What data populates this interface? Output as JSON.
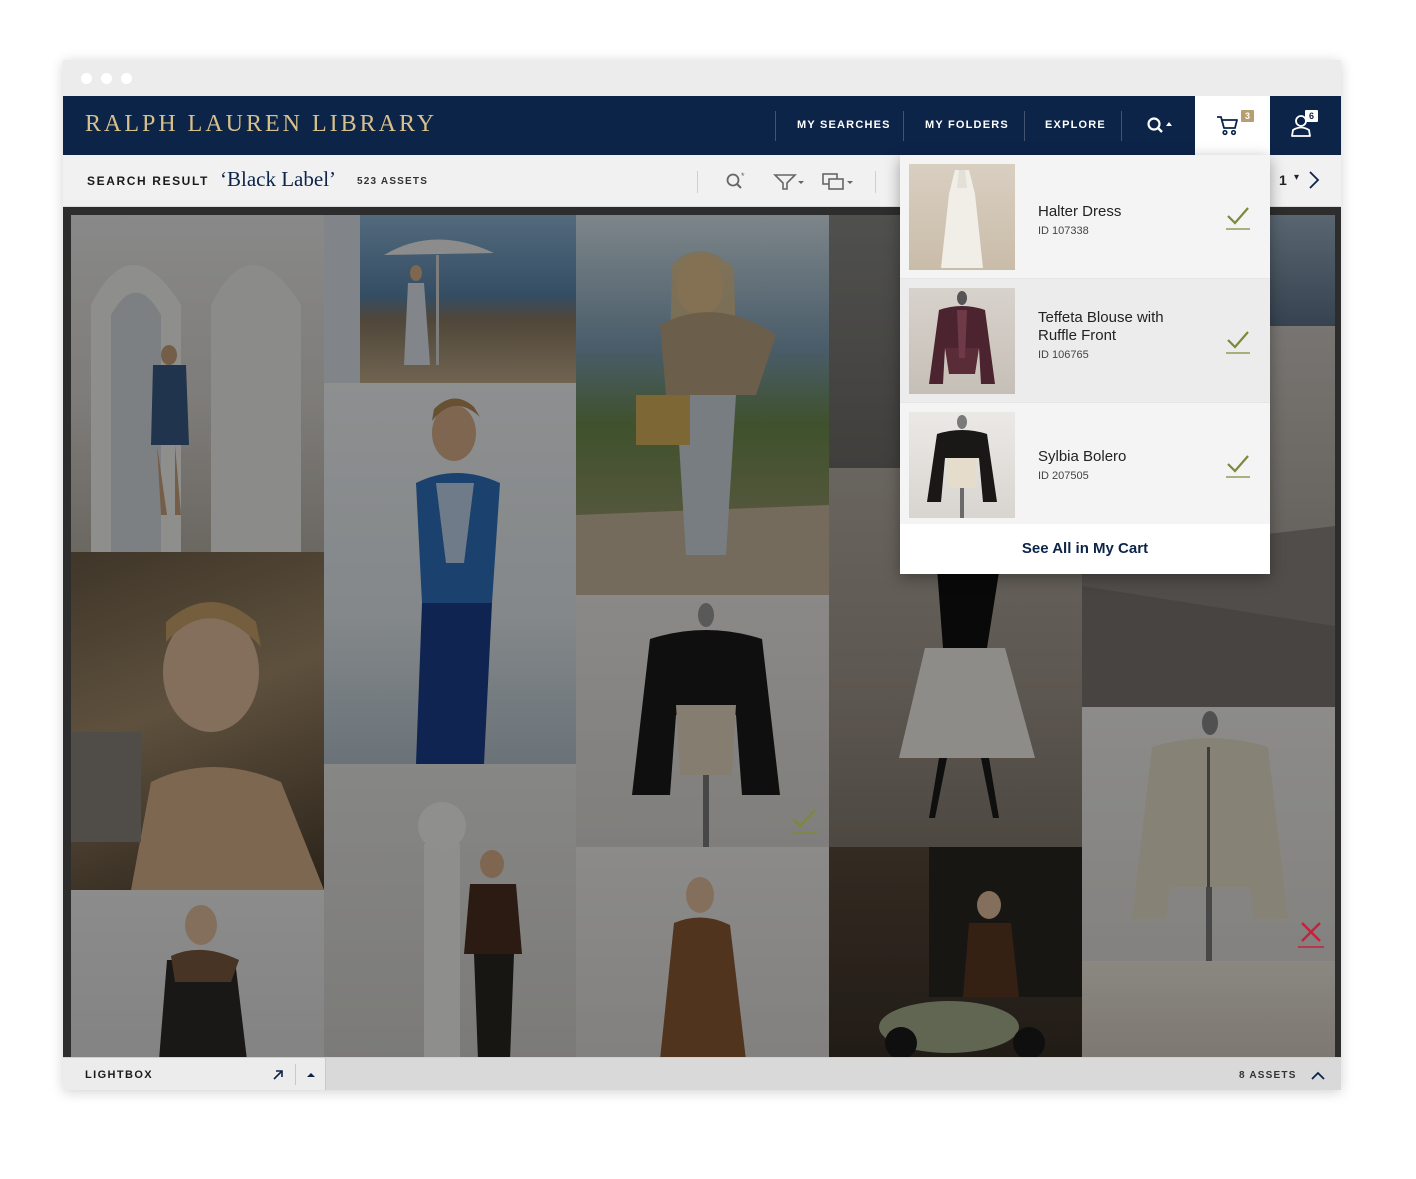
{
  "app": {
    "brand": "RALPH LAUREN LIBRARY"
  },
  "nav": {
    "my_searches": "MY SEARCHES",
    "my_folders": "MY FOLDERS",
    "explore": "EXPLORE",
    "search_icon": "search-icon",
    "cart_icon": "cart-icon",
    "cart_count": "3",
    "user_icon": "user-icon",
    "user_count": "6"
  },
  "search_bar": {
    "label": "SEARCH RESULT",
    "query": "‘Black Label’",
    "count": "523 ASSETS",
    "page": "1",
    "tools": [
      "zoom-search-icon",
      "filter-icon",
      "view-mode-icon"
    ]
  },
  "cart_dropdown": {
    "items": [
      {
        "name": "Halter Dress",
        "id": "ID 107338"
      },
      {
        "name": "Teffeta Blouse with Ruffle Front",
        "id": "ID 106765"
      },
      {
        "name": "Sylbia Bolero",
        "id": "ID 207505"
      }
    ],
    "see_all": "See All in My Cart"
  },
  "lightbox": {
    "label": "LIGHTBOX",
    "count": "8 ASSETS"
  },
  "colors": {
    "navy": "#0d2449",
    "gold": "#d8c08a",
    "check_green": "#7a8a3a",
    "remove_red": "#c4213a"
  }
}
